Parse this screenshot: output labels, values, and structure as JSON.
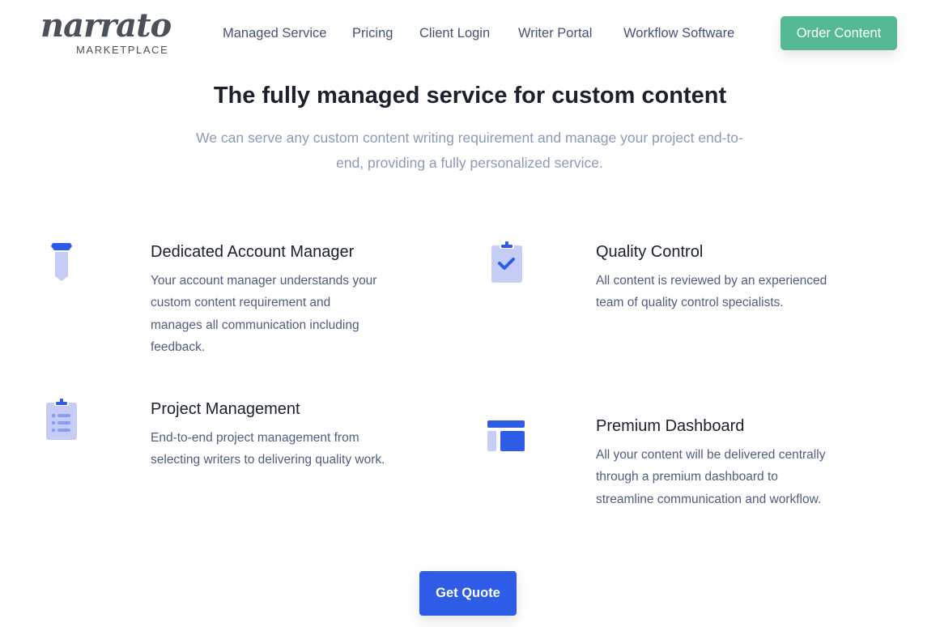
{
  "brand": {
    "logo_script": "narrato",
    "logo_sub": "MARKETPLACE"
  },
  "nav": {
    "items": [
      {
        "label": "Managed Service"
      },
      {
        "label": "Pricing"
      },
      {
        "label": "Client Login"
      },
      {
        "label": "Writer Portal"
      },
      {
        "label": "Workflow Software"
      }
    ],
    "cta_label": "Order Content"
  },
  "hero": {
    "title": "The fully managed service for custom content",
    "subtitle": "We can serve any custom content writing requirement and manage your project end-to-end, providing a fully personalized service."
  },
  "features": [
    {
      "icon": "tie-icon",
      "title": "Dedicated Account Manager",
      "description": "Your account manager understands your custom content requirement and manages all communication including feedback."
    },
    {
      "icon": "clipboard-check-icon",
      "title": "Quality Control",
      "description": "All content is reviewed by an experienced team of quality control specialists."
    },
    {
      "icon": "clipboard-list-icon",
      "title": "Project Management",
      "description": "End-to-end project management from selecting writers to delivering quality work."
    },
    {
      "icon": "dashboard-layout-icon",
      "title": "Premium Dashboard",
      "description": "All your content will be delivered centrally through a premium dashboard to streamline communication and workflow."
    }
  ],
  "cta": {
    "label": "Get Quote"
  },
  "colors": {
    "accent_blue": "#2f5ce6",
    "light_blue": "#c5cdf6",
    "green": "#55b994",
    "nav_text": "#435378",
    "body_text": "#4f5d80",
    "subtitle_text": "#8a9bb5"
  }
}
